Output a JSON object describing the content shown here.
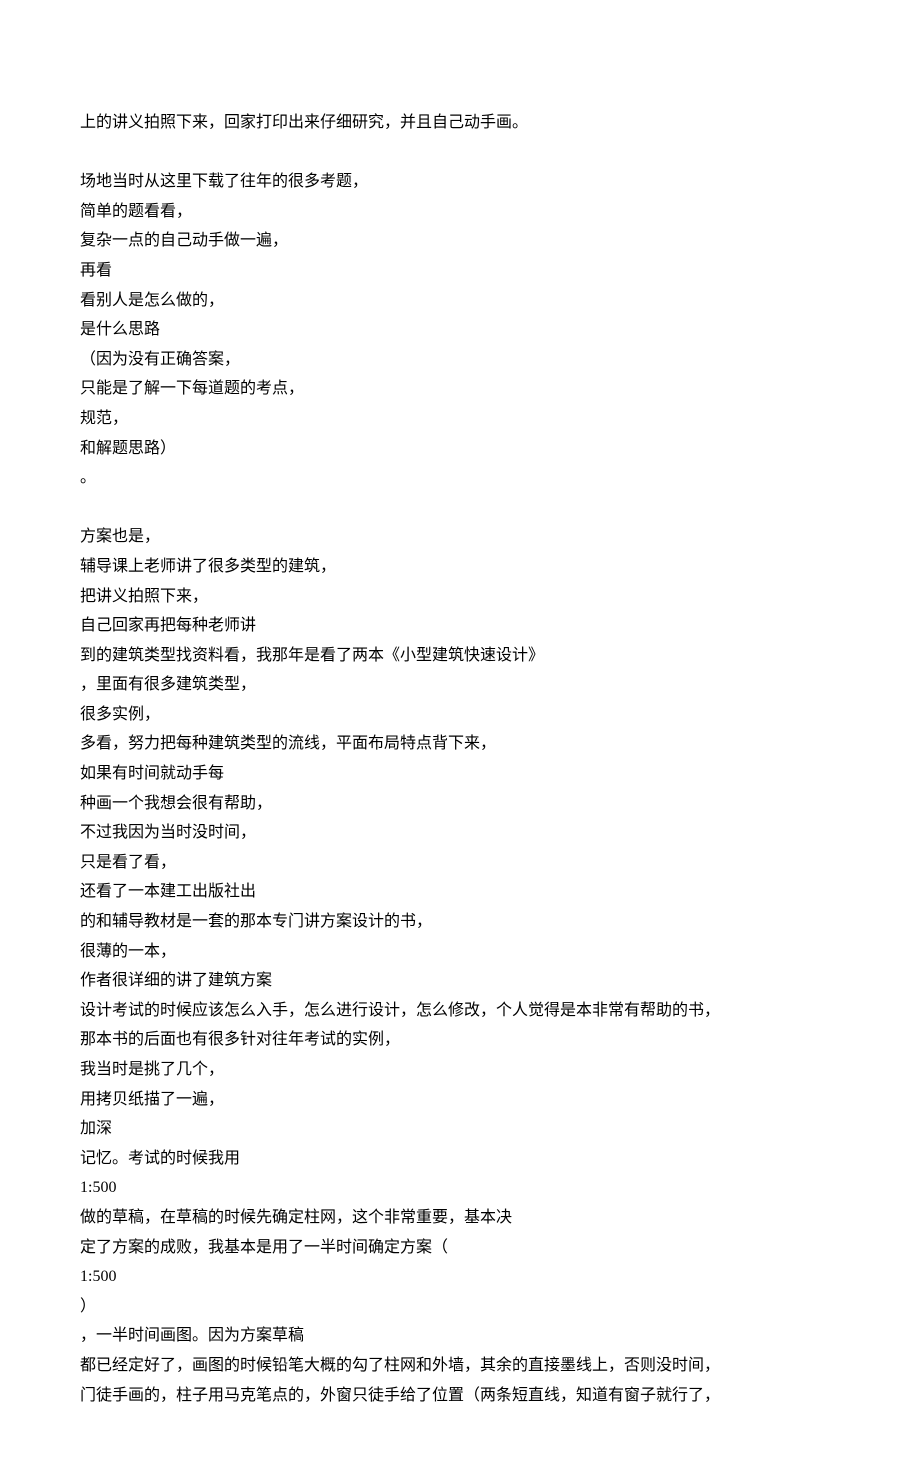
{
  "lines": [
    "上的讲义拍照下来，回家打印出来仔细研究，并且自己动手画。",
    "",
    "场地当时从这里下载了往年的很多考题，",
    "简单的题看看，",
    "复杂一点的自己动手做一遍，",
    "再看",
    "看别人是怎么做的，",
    "是什么思路",
    "（因为没有正确答案，",
    "只能是了解一下每道题的考点，",
    "规范，",
    "和解题思路）",
    "。",
    "",
    "方案也是，",
    "辅导课上老师讲了很多类型的建筑，",
    "把讲义拍照下来，",
    "自己回家再把每种老师讲",
    "到的建筑类型找资料看，我那年是看了两本《小型建筑快速设计》",
    "，里面有很多建筑类型，",
    "很多实例，",
    "多看，努力把每种建筑类型的流线，平面布局特点背下来，",
    "如果有时间就动手每",
    "种画一个我想会很有帮助，",
    "不过我因为当时没时间，",
    "只是看了看，",
    "还看了一本建工出版社出",
    "的和辅导教材是一套的那本专门讲方案设计的书，",
    "很薄的一本，",
    "作者很详细的讲了建筑方案",
    "设计考试的时候应该怎么入手，怎么进行设计，怎么修改，个人觉得是本非常有帮助的书，",
    "那本书的后面也有很多针对往年考试的实例，",
    "我当时是挑了几个，",
    "用拷贝纸描了一遍，",
    "加深",
    "记忆。考试的时候我用",
    "1:500",
    "做的草稿，在草稿的时候先确定柱网，这个非常重要，基本决",
    "定了方案的成败，我基本是用了一半时间确定方案（",
    "1:500",
    "）",
    "，一半时间画图。因为方案草稿",
    "都已经定好了，画图的时候铅笔大概的勾了柱网和外墙，其余的直接墨线上，否则没时间，",
    "门徒手画的，柱子用马克笔点的，外窗只徒手给了位置（两条短直线，知道有窗子就行了，"
  ]
}
